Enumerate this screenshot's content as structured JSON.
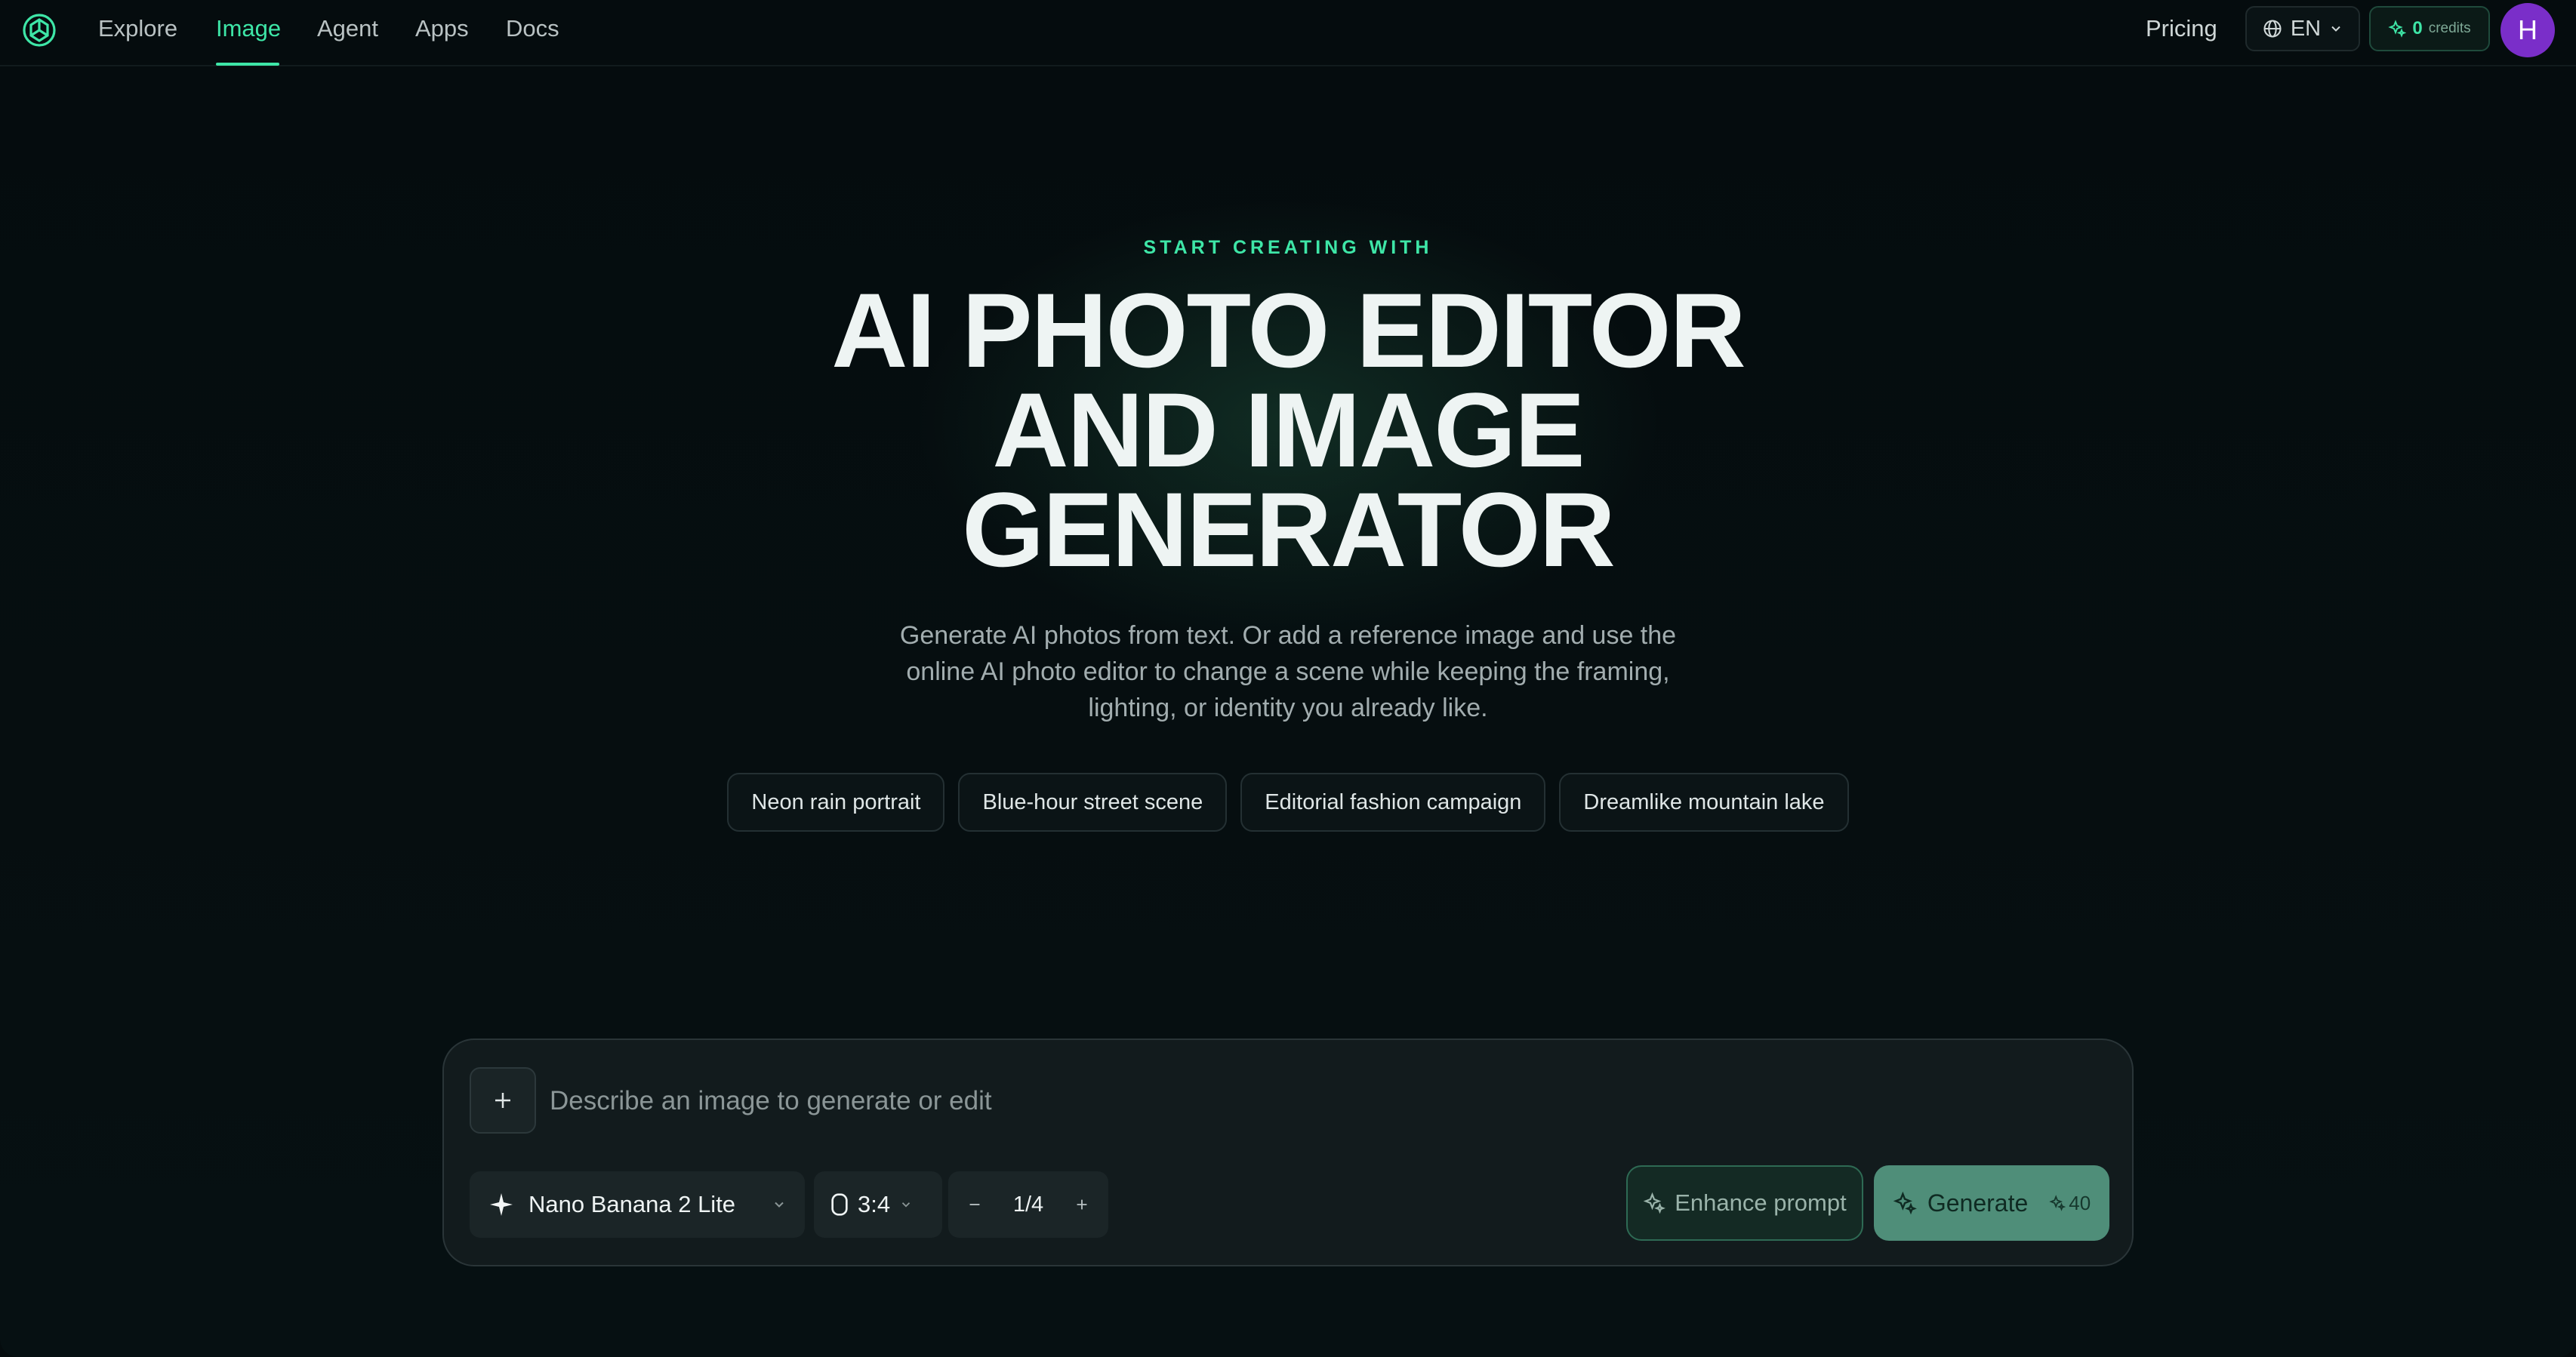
{
  "nav": {
    "logo_icon": "openai-knot-logo-icon",
    "links": [
      {
        "label": "Explore",
        "active": false
      },
      {
        "label": "Image",
        "active": true
      },
      {
        "label": "Agent",
        "active": false
      },
      {
        "label": "Apps",
        "active": false
      },
      {
        "label": "Docs",
        "active": false
      }
    ],
    "pricing_label": "Pricing",
    "language": {
      "label": "EN",
      "icon": "globe-icon"
    },
    "credits": {
      "count": "0",
      "label": "credits",
      "icon": "sparkle-icon"
    },
    "avatar_initial": "H"
  },
  "hero": {
    "eyebrow": "START CREATING WITH",
    "title_lines": [
      "AI PHOTO EDITOR",
      "AND IMAGE",
      "GENERATOR"
    ],
    "subtitle": "Generate AI photos from text. Or add a reference image and use the online AI photo editor to change a scene while keeping the framing, lighting, or identity you already like.",
    "chips": [
      "Neon rain portrait",
      "Blue-hour street scene",
      "Editorial fashion campaign",
      "Dreamlike mountain lake"
    ]
  },
  "prompt": {
    "placeholder": "Describe an image to generate or edit",
    "value": "",
    "model": "Nano Banana 2 Lite",
    "aspect_ratio": "3:4",
    "count": "1/4",
    "enhance_label": "Enhance prompt",
    "generate_label": "Generate",
    "generate_cost": "40"
  },
  "colors": {
    "accent": "#3ee6a7",
    "background": "#050c0e",
    "generate_button": "#4f8e79",
    "avatar": "#7a2ec9"
  }
}
